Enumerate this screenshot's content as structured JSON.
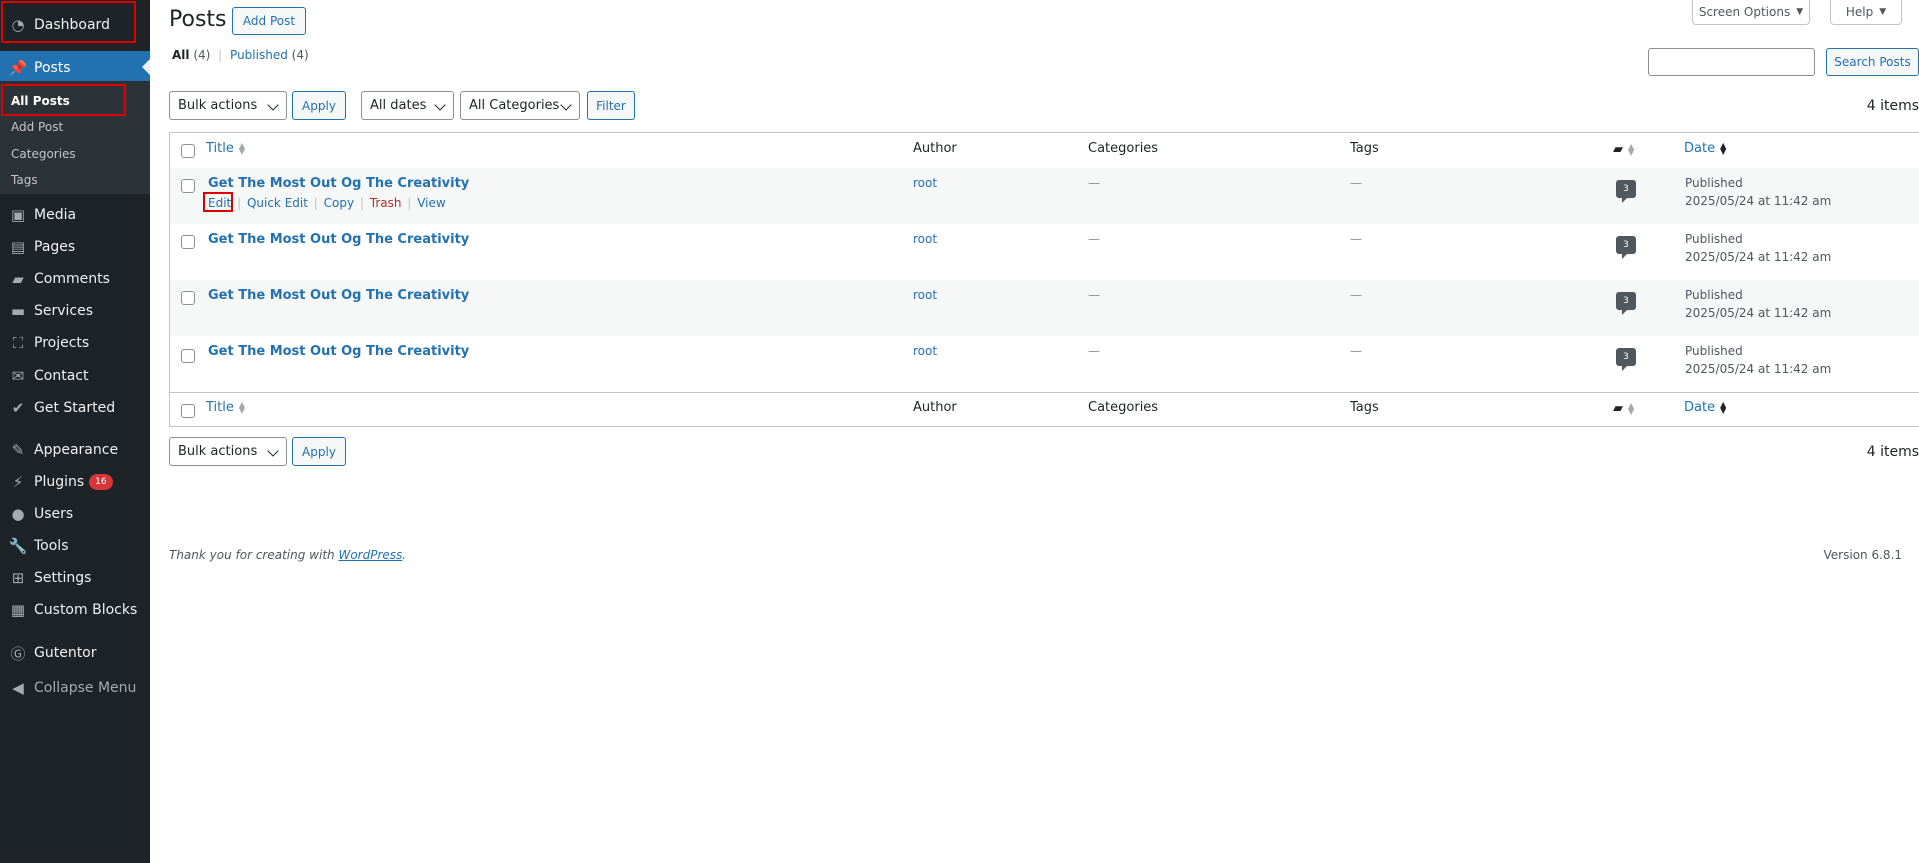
{
  "sidebar": {
    "items": [
      {
        "label": "Dashboard",
        "icon": "dashboard-icon"
      },
      {
        "label": "Posts",
        "icon": "pin-icon"
      },
      {
        "label": "Media",
        "icon": "media-icon"
      },
      {
        "label": "Pages",
        "icon": "pages-icon"
      },
      {
        "label": "Comments",
        "icon": "comments-icon"
      },
      {
        "label": "Services",
        "icon": "folder-icon"
      },
      {
        "label": "Projects",
        "icon": "projects-icon"
      },
      {
        "label": "Contact",
        "icon": "email-icon"
      },
      {
        "label": "Get Started",
        "icon": "check-icon"
      },
      {
        "label": "Appearance",
        "icon": "brush-icon"
      },
      {
        "label": "Plugins",
        "icon": "plugin-icon",
        "badge": "16"
      },
      {
        "label": "Users",
        "icon": "user-icon"
      },
      {
        "label": "Tools",
        "icon": "wrench-icon"
      },
      {
        "label": "Settings",
        "icon": "settings-icon"
      },
      {
        "label": "Custom Blocks",
        "icon": "blocks-icon"
      },
      {
        "label": "Gutentor",
        "icon": "gutentor-icon"
      },
      {
        "label": "Collapse Menu",
        "icon": "collapse-icon"
      }
    ],
    "submenu": [
      "All Posts",
      "Add Post",
      "Categories",
      "Tags"
    ]
  },
  "header": {
    "title": "Posts",
    "add_button": "Add Post",
    "screen_options": "Screen Options",
    "help": "Help"
  },
  "views": {
    "all_label": "All",
    "all_count": "(4)",
    "sep": "|",
    "published_label": "Published",
    "published_count": "(4)"
  },
  "search": {
    "value": "",
    "button": "Search Posts"
  },
  "filters": {
    "bulk_actions": "Bulk actions",
    "apply": "Apply",
    "dates": "All dates",
    "categories": "All Categories",
    "filter": "Filter",
    "item_count": "4 items"
  },
  "table": {
    "columns": {
      "title": "Title",
      "author": "Author",
      "categories": "Categories",
      "tags": "Tags",
      "date": "Date"
    },
    "rows": [
      {
        "title": "Get The Most Out Og The Creativity",
        "author": "root",
        "categories": "—",
        "tags": "—",
        "comments": "3",
        "status": "Published",
        "date": "2025/05/24 at 11:42 am"
      },
      {
        "title": "Get The Most Out Og The Creativity",
        "author": "root",
        "categories": "—",
        "tags": "—",
        "comments": "3",
        "status": "Published",
        "date": "2025/05/24 at 11:42 am"
      },
      {
        "title": "Get The Most Out Og The Creativity",
        "author": "root",
        "categories": "—",
        "tags": "—",
        "comments": "3",
        "status": "Published",
        "date": "2025/05/24 at 11:42 am"
      },
      {
        "title": "Get The Most Out Og The Creativity",
        "author": "root",
        "categories": "—",
        "tags": "—",
        "comments": "3",
        "status": "Published",
        "date": "2025/05/24 at 11:42 am"
      }
    ],
    "row_actions": {
      "edit": "Edit",
      "quick_edit": "Quick Edit",
      "copy": "Copy",
      "trash": "Trash",
      "view": "View",
      "sep": "|"
    }
  },
  "footer": {
    "thanks_prefix": "Thank you for creating with ",
    "thanks_link": "WordPress",
    "thanks_suffix": ".",
    "version": "Version 6.8.1"
  }
}
